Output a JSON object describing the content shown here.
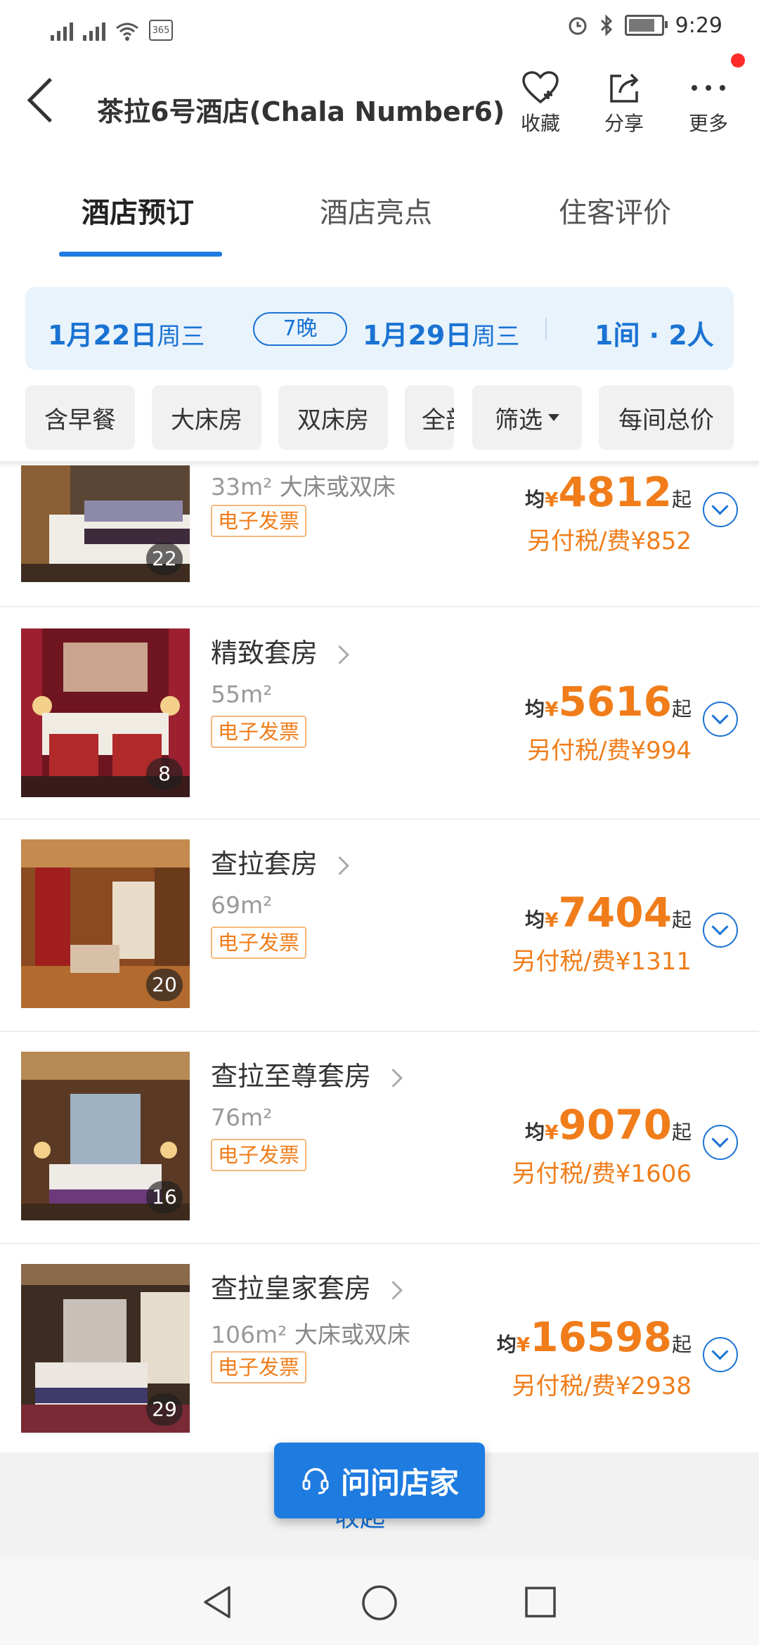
{
  "status_bar": {
    "time": "9:29",
    "calendar_badge": "365"
  },
  "header": {
    "title": "茶拉6号酒店(Chala Number6)",
    "favorite_label": "收藏",
    "share_label": "分享",
    "more_label": "更多"
  },
  "tabs": [
    {
      "label": "酒店预订",
      "active": true
    },
    {
      "label": "酒店亮点",
      "active": false
    },
    {
      "label": "住客评价",
      "active": false
    }
  ],
  "dates": {
    "checkin_date": "1月22日",
    "checkin_day": "周三",
    "nights": "7晚",
    "checkout_date": "1月29日",
    "checkout_day": "周三",
    "rooms_guests": "1间 · 2人"
  },
  "filters": [
    "含早餐",
    "大床房",
    "双床房",
    "全部",
    "筛选",
    "每间总价"
  ],
  "rooms": [
    {
      "name": "",
      "area": "33m²",
      "bed": "大床或双床",
      "invoice": "电子发票",
      "photo_count": "22",
      "avg_label": "均",
      "currency": "¥",
      "price": "4812",
      "from_label": "起",
      "tax": "另付税/费¥852"
    },
    {
      "name": "精致套房",
      "area": "55m²",
      "bed": "",
      "invoice": "电子发票",
      "photo_count": "8",
      "avg_label": "均",
      "currency": "¥",
      "price": "5616",
      "from_label": "起",
      "tax": "另付税/费¥994"
    },
    {
      "name": "查拉套房",
      "area": "69m²",
      "bed": "",
      "invoice": "电子发票",
      "photo_count": "20",
      "avg_label": "均",
      "currency": "¥",
      "price": "7404",
      "from_label": "起",
      "tax": "另付税/费¥1311"
    },
    {
      "name": "查拉至尊套房",
      "area": "76m²",
      "bed": "",
      "invoice": "电子发票",
      "photo_count": "16",
      "avg_label": "均",
      "currency": "¥",
      "price": "9070",
      "from_label": "起",
      "tax": "另付税/费¥1606"
    },
    {
      "name": "查拉皇家套房",
      "area": "106m²",
      "bed": "大床或双床",
      "invoice": "电子发票",
      "photo_count": "29",
      "avg_label": "均",
      "currency": "¥",
      "price": "16598",
      "from_label": "起",
      "tax": "另付税/费¥2938"
    }
  ],
  "footer": {
    "collapse_label": "收起",
    "ask_label": "问问店家"
  },
  "colors": {
    "accent": "#1e7be0",
    "price": "#f07d1a",
    "date_bg": "#e9f3fc"
  }
}
